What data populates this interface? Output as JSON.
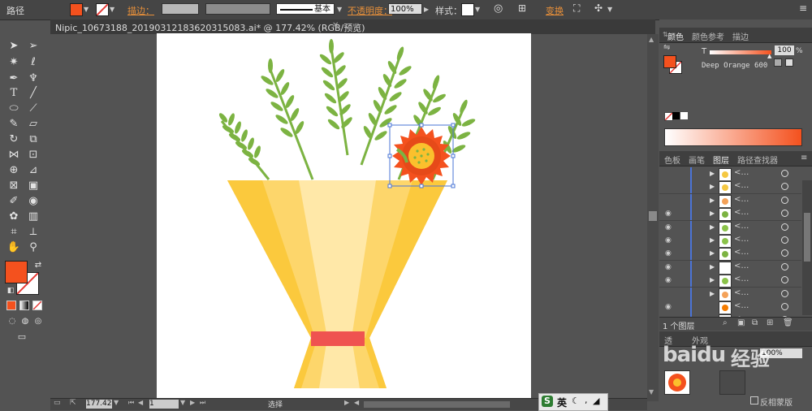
{
  "control_bar": {
    "object_type": "路径",
    "stroke_label": "描边：",
    "brush_style": "基本",
    "opacity_label": "不透明度：",
    "opacity_value": "100%",
    "style_label": "样式：",
    "transform_label": "变换"
  },
  "document_tab": {
    "title": "Nipic_10673188_20190312183620315083.ai* @ 177.42% (RGB/预览)"
  },
  "status_bar": {
    "zoom": "177.42",
    "artboard_number": "1",
    "tool_name": "选择"
  },
  "color_panel": {
    "tabs": [
      "颜色",
      "颜色参考",
      "描边"
    ],
    "channel": "T",
    "tint_value": "100",
    "tint_unit": "%",
    "swatch_name": "Deep Orange 600",
    "fill_color": "#f4511e"
  },
  "layers_panel": {
    "tabs": [
      "色板",
      "画笔",
      "图层",
      "路径查找器"
    ],
    "rows": [
      {
        "visible": false,
        "expand": true,
        "name": "<…",
        "thumb": "#f5c842"
      },
      {
        "visible": false,
        "expand": true,
        "name": "<…",
        "thumb": "#f5c842"
      },
      {
        "visible": false,
        "expand": true,
        "name": "<…",
        "thumb": "#f4a259"
      },
      {
        "visible": true,
        "expand": true,
        "name": "<…",
        "thumb": "#7cb342"
      },
      {
        "visible": true,
        "expand": true,
        "name": "<…",
        "thumb": "#8bc34a"
      },
      {
        "visible": true,
        "expand": true,
        "name": "<…",
        "thumb": "#8bc34a"
      },
      {
        "visible": true,
        "expand": true,
        "name": "<…",
        "thumb": "#7cb342"
      },
      {
        "visible": true,
        "expand": true,
        "name": "<…",
        "thumb": "#ffffff"
      },
      {
        "visible": true,
        "expand": true,
        "name": "<…",
        "thumb": "#8bc34a"
      },
      {
        "visible": false,
        "expand": true,
        "name": "<…",
        "thumb": "#f4a259"
      },
      {
        "visible": true,
        "expand": false,
        "name": "<…",
        "thumb": "#f57c00"
      },
      {
        "visible": true,
        "expand": false,
        "name": "<…",
        "thumb": "#f57c00"
      }
    ],
    "layer_count": "1 个图层"
  },
  "bottom_panel": {
    "tabs": [
      "透",
      "外观"
    ],
    "opacity": "100%",
    "knockout_label": "反相蒙版"
  },
  "ime": {
    "logo": "S",
    "lang": "英"
  },
  "watermark": {
    "text": "经验",
    "sub": "baidu"
  }
}
